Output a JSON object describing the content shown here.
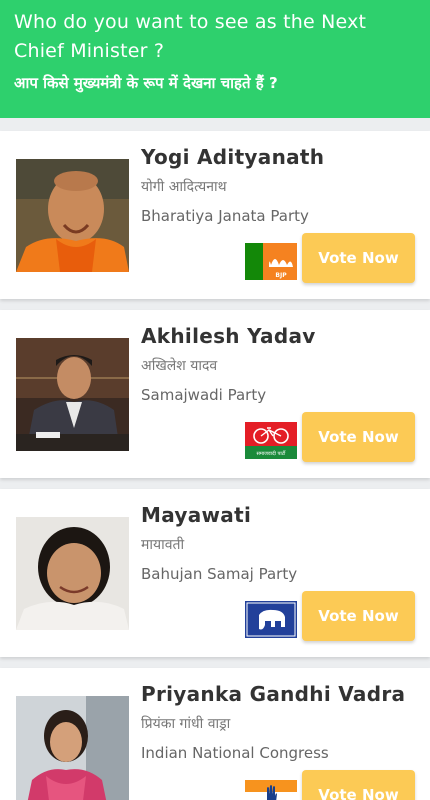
{
  "header": {
    "question_en": "Who do you want to see as the Next Chief Minister ?",
    "question_hi": "आप किसे मुख्यमंत्री के रूप में देखना चाहते हैं ?"
  },
  "colors": {
    "header_bg": "#2ed06d",
    "vote_button_bg": "#fcca55",
    "page_bg": "#eceef0"
  },
  "candidates": [
    {
      "name": "Yogi Adityanath",
      "name_hi": "योगी आदित्यनाथ",
      "party": "Bharatiya Janata Party",
      "party_logo": "bjp-lotus-logo",
      "logo_text": "BJP",
      "vote_label": "Vote Now"
    },
    {
      "name": "Akhilesh Yadav",
      "name_hi": "अखिलेश यादव",
      "party": "Samajwadi Party",
      "party_logo": "sp-bicycle-logo",
      "logo_text": "समाजवादी पार्टी",
      "vote_label": "Vote Now"
    },
    {
      "name": "Mayawati",
      "name_hi": "मायावती",
      "party": "Bahujan Samaj Party",
      "party_logo": "bsp-elephant-logo",
      "vote_label": "Vote Now"
    },
    {
      "name": "Priyanka Gandhi Vadra",
      "name_hi": "प्रियंका गांधी वाड्रा",
      "party": "Indian National Congress",
      "party_logo": "inc-hand-logo",
      "vote_label": "Vote Now"
    }
  ]
}
